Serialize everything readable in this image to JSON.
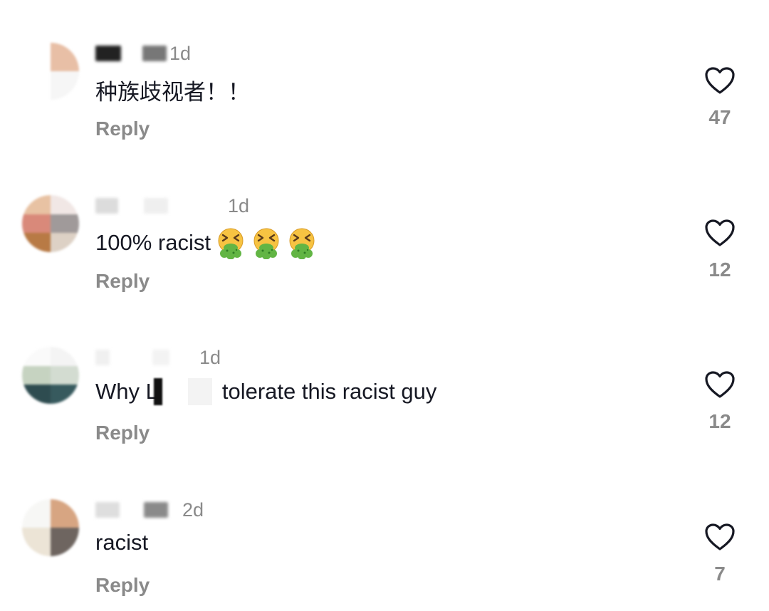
{
  "comments": [
    {
      "time": "1d",
      "text": "种族歧视者！！",
      "reply_label": "Reply",
      "likes": "47",
      "avatar_colors": [
        "#ffffff",
        "#e8bfa6",
        "#ffffff",
        "#f6f6f6"
      ]
    },
    {
      "time": "1d",
      "text": "100% racist",
      "emoji_count": 3,
      "reply_label": "Reply",
      "likes": "12",
      "avatar_colors": [
        "#e8c2a3",
        "#f1e7e5",
        "#d9897a",
        "#a09a9a",
        "#b87a45",
        "#ddd1c5"
      ]
    },
    {
      "time": "1d",
      "text_before": "Why L",
      "text_after": "tolerate this racist guy",
      "reply_label": "Reply",
      "likes": "12",
      "avatar_colors": [
        "#fafafa",
        "#f4f4f4",
        "#c6d3c1",
        "#d3dcd1",
        "#2e4c50",
        "#375a5e"
      ]
    },
    {
      "time": "2d",
      "text": "racist",
      "reply_label": "Reply",
      "likes": "7",
      "avatar_colors": [
        "#f7f7f5",
        "#d7a582",
        "#ece4d6",
        "#6e6560"
      ]
    }
  ],
  "colors": {
    "text": "#161823",
    "muted": "#8a8a8a",
    "vomit_green": "#62b544",
    "face_yellow": "#f7c342"
  },
  "icons": {
    "like": "heart-outline-icon",
    "emoji": "face-vomiting-emoji-icon"
  }
}
